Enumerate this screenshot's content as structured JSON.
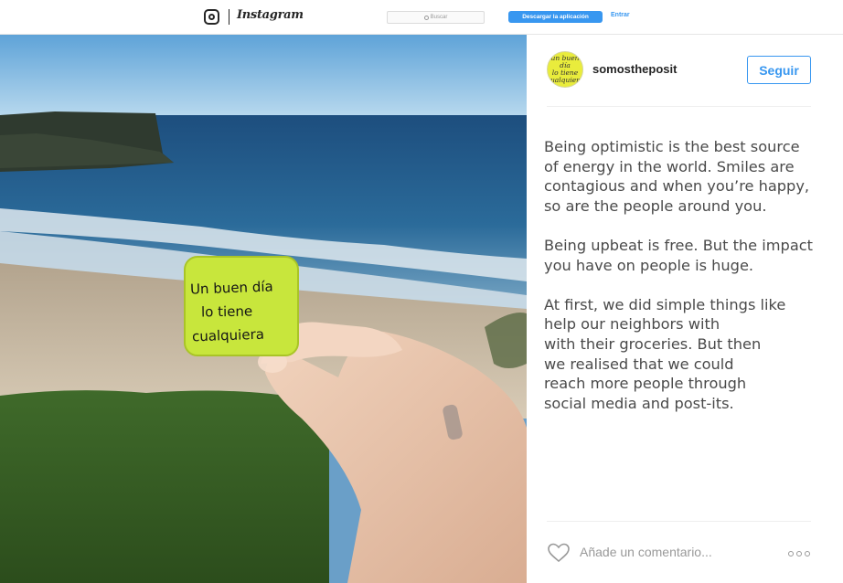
{
  "topbar": {
    "brand": "Instagram",
    "search_placeholder": "Buscar",
    "download_label": "Descargar la aplicación",
    "login_label": "Entrar"
  },
  "photo": {
    "postit_lines": [
      "Un buen día",
      "lo tiene",
      "cualquiera"
    ]
  },
  "post": {
    "avatar_lines": "un buen día\nlo tiene\ncualquiera",
    "username": "somostheposit",
    "follow_label": "Seguir",
    "caption": {
      "p1": [
        "Being optimistic is the best source",
        "of energy in the world. Smiles are",
        "contagious and when you’re happy,",
        "so are the people around you."
      ],
      "p2": [
        "Being upbeat is free. But the impact",
        "you have on people is huge."
      ],
      "p3": [
        "At first, we did simple things like",
        "help our neighbors with",
        "with their groceries. But then",
        "we realised that we could",
        "reach more people through",
        "social media and post-its."
      ]
    },
    "comment_placeholder": "Añade un comentario..."
  },
  "colors": {
    "accent": "#3897f0",
    "postit": "#c8e63c"
  },
  "icons": {
    "logo": "instagram-camera-icon",
    "search": "search-icon",
    "like": "heart-icon",
    "more": "more-options-icon"
  }
}
